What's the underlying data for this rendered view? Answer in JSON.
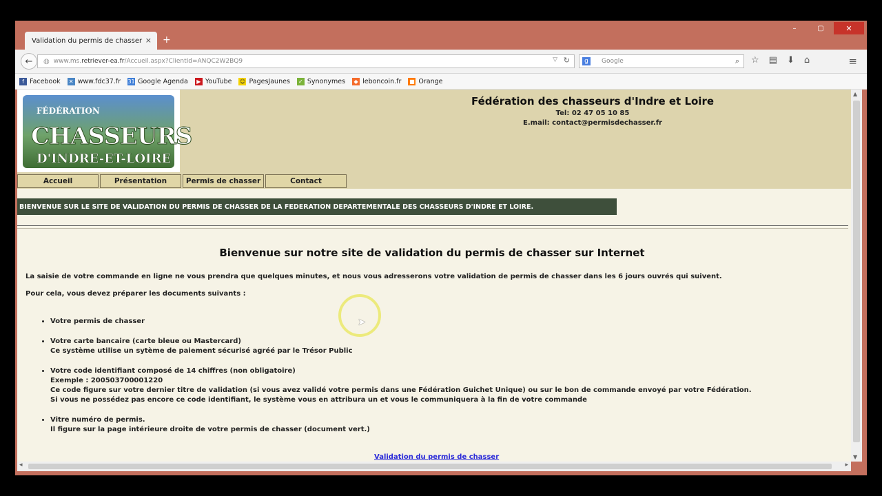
{
  "browser": {
    "tab_title": "Validation du permis de chasser",
    "tab_close": "×",
    "new_tab": "+",
    "url_prefix": "www.ms.",
    "url_domain": "retriever-ea.fr",
    "url_rest": "/Accueil.aspx?ClientId=ANQC2W2BQ9",
    "search_placeholder": "Google",
    "window_controls": [
      "–",
      "▢",
      "✕"
    ]
  },
  "bookmarks": [
    {
      "label": "Facebook",
      "color": "#3b5998",
      "icon": "facebook-icon"
    },
    {
      "label": "www.fdc37.fr",
      "color": "#4a86c5",
      "icon": "fdc37-icon"
    },
    {
      "label": "Google Agenda",
      "color": "#3f7fd8",
      "icon": "calendar-icon"
    },
    {
      "label": "YouTube",
      "color": "#cc181e",
      "icon": "youtube-icon"
    },
    {
      "label": "PagesJaunes",
      "color": "#f5d300",
      "icon": "pagesjaunes-icon"
    },
    {
      "label": "Synonymes",
      "color": "#7bb33a",
      "icon": "synonymes-icon"
    },
    {
      "label": "leboncoin.fr",
      "color": "#f56b2a",
      "icon": "leboncoin-icon"
    },
    {
      "label": "Orange",
      "color": "#ff7900",
      "icon": "orange-icon"
    }
  ],
  "site": {
    "logo_line1": "FÉDÉRATION",
    "logo_line2": "CHASSEURS",
    "logo_line3": "D'INDRE-ET-LOIRE",
    "title": "Fédération des chasseurs d'Indre et Loire",
    "tel": "Tel: 02 47 05 10 85",
    "email": "E.mail: contact@permisdechasser.fr",
    "nav": [
      "Accueil",
      "Présentation",
      "Permis de chasser",
      "Contact"
    ],
    "banner": "BIENVENUE SUR LE SITE DE VALIDATION DU PERMIS DE CHASSER DE LA FEDERATION DEPARTEMENTALE DES CHASSEURS D'INDRE ET LOIRE."
  },
  "content": {
    "heading": "Bienvenue sur notre site de validation du permis de chasser sur Internet",
    "intro": "La saisie de votre commande en ligne ne vous prendra que quelques minutes, et nous vous adresserons votre validation de permis de chasser dans les 6 jours ouvrés qui suivent.",
    "prep": "Pour cela, vous devez préparer les documents suivants :",
    "items": [
      {
        "lines": [
          "Votre permis de chasser"
        ]
      },
      {
        "lines": [
          "Votre carte bancaire (carte bleue ou Mastercard)",
          "Ce système utilise un sytème de paiement sécurisé agréé par le Trésor Public"
        ]
      },
      {
        "lines": [
          "Votre code identifiant composé de 14 chiffres (non obligatoire)",
          "Exemple : 200503700001220",
          "Ce code figure sur votre dernier titre de validation (si vous avez validé votre permis dans une Fédération Guichet Unique) ou sur le bon de commande envoyé par votre Fédération.",
          "Si vous ne possédez pas encore ce code identifiant, le système vous en attribura un et vous le communiquera à la fin de votre commande"
        ]
      },
      {
        "lines": [
          "Vitre numéro de permis.",
          "Il figure sur la page intérieure droite de votre permis de chasser (document vert.)"
        ]
      }
    ],
    "link": "Validation du permis de chasser"
  }
}
